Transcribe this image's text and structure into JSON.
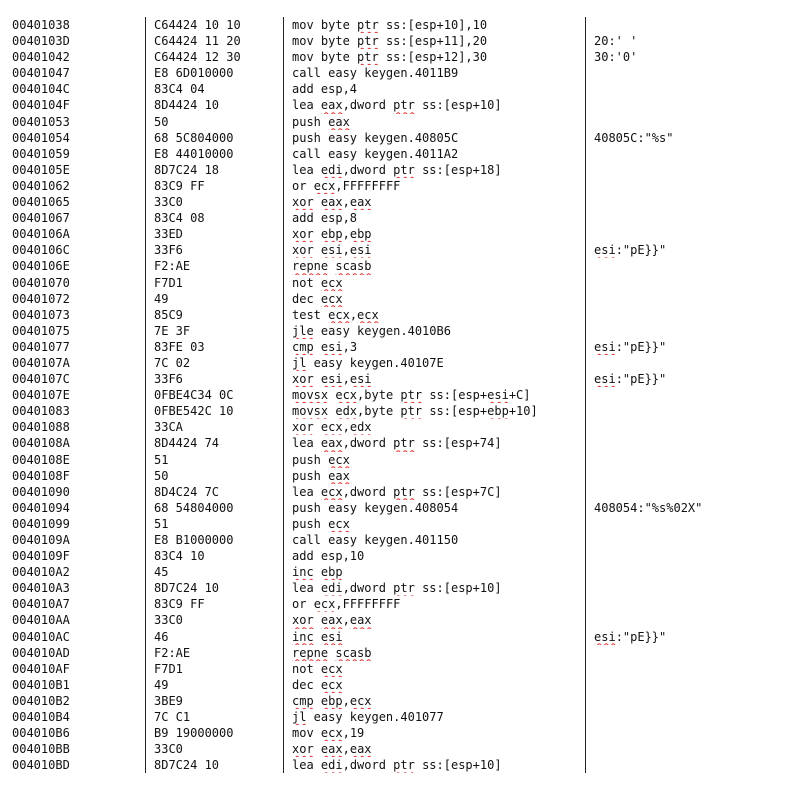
{
  "columns": [
    "address",
    "bytes",
    "instruction",
    "comment"
  ],
  "rows": [
    {
      "addr": "00401038",
      "bytes": "C64424 10 10",
      "instr": "mov byte ptr ss:[esp+10],10",
      "comment": ""
    },
    {
      "addr": "0040103D",
      "bytes": "C64424 11 20",
      "instr": "mov byte ptr ss:[esp+11],20",
      "comment": "20:' '"
    },
    {
      "addr": "00401042",
      "bytes": "C64424 12 30",
      "instr": "mov byte ptr ss:[esp+12],30",
      "comment": "30:'0'"
    },
    {
      "addr": "00401047",
      "bytes": "E8 6D010000",
      "instr": "call easy keygen.4011B9",
      "comment": ""
    },
    {
      "addr": "0040104C",
      "bytes": "83C4 04",
      "instr": "add esp,4",
      "comment": ""
    },
    {
      "addr": "0040104F",
      "bytes": "8D4424 10",
      "instr": "lea eax,dword ptr ss:[esp+10]",
      "comment": ""
    },
    {
      "addr": "00401053",
      "bytes": "50",
      "instr": "push eax",
      "comment": ""
    },
    {
      "addr": "00401054",
      "bytes": "68 5C804000",
      "instr": "push easy keygen.40805C",
      "comment": "40805C:\"%s\""
    },
    {
      "addr": "00401059",
      "bytes": "E8 44010000",
      "instr": "call easy keygen.4011A2",
      "comment": ""
    },
    {
      "addr": "0040105E",
      "bytes": "8D7C24 18",
      "instr": "lea edi,dword ptr ss:[esp+18]",
      "comment": ""
    },
    {
      "addr": "00401062",
      "bytes": "83C9 FF",
      "instr": "or ecx,FFFFFFFF",
      "comment": ""
    },
    {
      "addr": "00401065",
      "bytes": "33C0",
      "instr": "xor eax,eax",
      "comment": ""
    },
    {
      "addr": "00401067",
      "bytes": "83C4 08",
      "instr": "add esp,8",
      "comment": ""
    },
    {
      "addr": "0040106A",
      "bytes": "33ED",
      "instr": "xor ebp,ebp",
      "comment": ""
    },
    {
      "addr": "0040106C",
      "bytes": "33F6",
      "instr": "xor esi,esi",
      "comment": "esi:\"pE}}\""
    },
    {
      "addr": "0040106E",
      "bytes": "F2:AE",
      "instr": "repne scasb",
      "comment": ""
    },
    {
      "addr": "00401070",
      "bytes": "F7D1",
      "instr": "not ecx",
      "comment": ""
    },
    {
      "addr": "00401072",
      "bytes": "49",
      "instr": "dec ecx",
      "comment": ""
    },
    {
      "addr": "00401073",
      "bytes": "85C9",
      "instr": "test ecx,ecx",
      "comment": ""
    },
    {
      "addr": "00401075",
      "bytes": "7E 3F",
      "instr": "jle easy keygen.4010B6",
      "comment": ""
    },
    {
      "addr": "00401077",
      "bytes": "83FE 03",
      "instr": "cmp esi,3",
      "comment": "esi:\"pE}}\""
    },
    {
      "addr": "0040107A",
      "bytes": "7C 02",
      "instr": "jl easy keygen.40107E",
      "comment": ""
    },
    {
      "addr": "0040107C",
      "bytes": "33F6",
      "instr": "xor esi,esi",
      "comment": "esi:\"pE}}\""
    },
    {
      "addr": "0040107E",
      "bytes": "0FBE4C34 0C",
      "instr": "movsx ecx,byte ptr ss:[esp+esi+C]",
      "comment": ""
    },
    {
      "addr": "00401083",
      "bytes": "0FBE542C 10",
      "instr": "movsx edx,byte ptr ss:[esp+ebp+10]",
      "comment": ""
    },
    {
      "addr": "00401088",
      "bytes": "33CA",
      "instr": "xor ecx,edx",
      "comment": ""
    },
    {
      "addr": "0040108A",
      "bytes": "8D4424 74",
      "instr": "lea eax,dword ptr ss:[esp+74]",
      "comment": ""
    },
    {
      "addr": "0040108E",
      "bytes": "51",
      "instr": "push ecx",
      "comment": ""
    },
    {
      "addr": "0040108F",
      "bytes": "50",
      "instr": "push eax",
      "comment": ""
    },
    {
      "addr": "00401090",
      "bytes": "8D4C24 7C",
      "instr": "lea ecx,dword ptr ss:[esp+7C]",
      "comment": ""
    },
    {
      "addr": "00401094",
      "bytes": "68 54804000",
      "instr": "push easy keygen.408054",
      "comment": "408054:\"%s%02X\""
    },
    {
      "addr": "00401099",
      "bytes": "51",
      "instr": "push ecx",
      "comment": ""
    },
    {
      "addr": "0040109A",
      "bytes": "E8 B1000000",
      "instr": "call easy keygen.401150",
      "comment": ""
    },
    {
      "addr": "0040109F",
      "bytes": "83C4 10",
      "instr": "add esp,10",
      "comment": ""
    },
    {
      "addr": "004010A2",
      "bytes": "45",
      "instr": "inc ebp",
      "comment": ""
    },
    {
      "addr": "004010A3",
      "bytes": "8D7C24 10",
      "instr": "lea edi,dword ptr ss:[esp+10]",
      "comment": ""
    },
    {
      "addr": "004010A7",
      "bytes": "83C9 FF",
      "instr": "or ecx,FFFFFFFF",
      "comment": ""
    },
    {
      "addr": "004010AA",
      "bytes": "33C0",
      "instr": "xor eax,eax",
      "comment": ""
    },
    {
      "addr": "004010AC",
      "bytes": "46",
      "instr": "inc esi",
      "comment": "esi:\"pE}}\""
    },
    {
      "addr": "004010AD",
      "bytes": "F2:AE",
      "instr": "repne scasb",
      "comment": ""
    },
    {
      "addr": "004010AF",
      "bytes": "F7D1",
      "instr": "not ecx",
      "comment": ""
    },
    {
      "addr": "004010B1",
      "bytes": "49",
      "instr": "dec ecx",
      "comment": ""
    },
    {
      "addr": "004010B2",
      "bytes": "3BE9",
      "instr": "cmp ebp,ecx",
      "comment": ""
    },
    {
      "addr": "004010B4",
      "bytes": "7C C1",
      "instr": "jl easy keygen.401077",
      "comment": ""
    },
    {
      "addr": "004010B6",
      "bytes": "B9 19000000",
      "instr": "mov ecx,19",
      "comment": ""
    },
    {
      "addr": "004010BB",
      "bytes": "33C0",
      "instr": "xor eax,eax",
      "comment": ""
    },
    {
      "addr": "004010BD",
      "bytes": "8D7C24 10",
      "instr": "lea edi,dword ptr ss:[esp+10]",
      "comment": ""
    }
  ]
}
